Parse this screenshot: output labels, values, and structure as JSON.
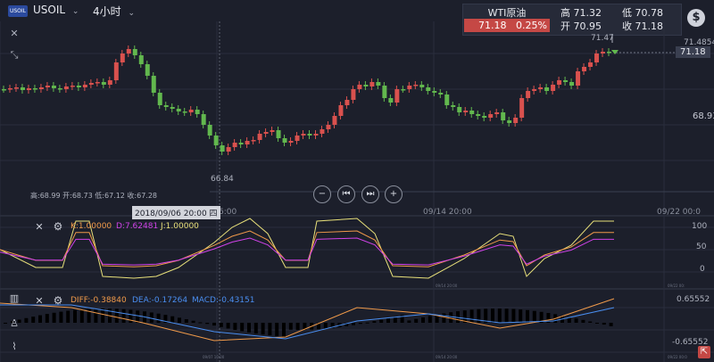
{
  "header": {
    "badge": "USOIL",
    "symbol": "USOIL",
    "period": "4小时",
    "chevron": "⌄"
  },
  "quote": {
    "name": "WTI原油",
    "price": "71.18",
    "change": "0.25%",
    "high": "高 71.32",
    "low": "低 70.78",
    "open": "开 70.95",
    "close": "收 71.18",
    "colors": {
      "price_bg": "#c54845"
    }
  },
  "price_panel": {
    "max_label": "71.47",
    "max_price": 71.47,
    "min_label": "66.84",
    "min_price": 66.84,
    "top_right": "71.4854",
    "current": "71.18",
    "right_level": "68.93",
    "ohlc_text": "高:68.99 开:68.73 低:67.12 收:67.28",
    "x_labels": [
      "6:00",
      "09/14 20:00",
      "09/22 00:0"
    ],
    "cursor_time": "2018/09/06 20:00 四"
  },
  "controls": {
    "zoom_out": "−",
    "prev": "⏮",
    "next": "⏭",
    "zoom_in": "+"
  },
  "kdj": {
    "k": "K:1.00000",
    "d": "D:7.62481",
    "j": "J:1.00000",
    "axis": [
      "100",
      "50",
      "0"
    ],
    "ticks": [
      "09/14 20:00",
      "09/22 00:"
    ],
    "colors": {
      "k": "#f09a4a",
      "d": "#d042e8",
      "j": "#e8e07a"
    }
  },
  "macd": {
    "diff": "DIFF:-0.38840",
    "dea": "DEA:-0.17264",
    "macd": "MACD:-0.43151",
    "top": "0.65552",
    "bottom": "-0.65552",
    "ticks": [
      "09/07 10:00",
      "09/14 20:00",
      "09/22 00:0"
    ],
    "colors": {
      "diff": "#f09a4a",
      "dea": "#4a8ef0",
      "bar_up": "#d9514e",
      "bar_down": "#62b84e"
    }
  },
  "colors": {
    "up": "#d9514e",
    "down": "#62b84e",
    "bg": "#1c1f2b",
    "grid": "#2a2e3c"
  }
}
